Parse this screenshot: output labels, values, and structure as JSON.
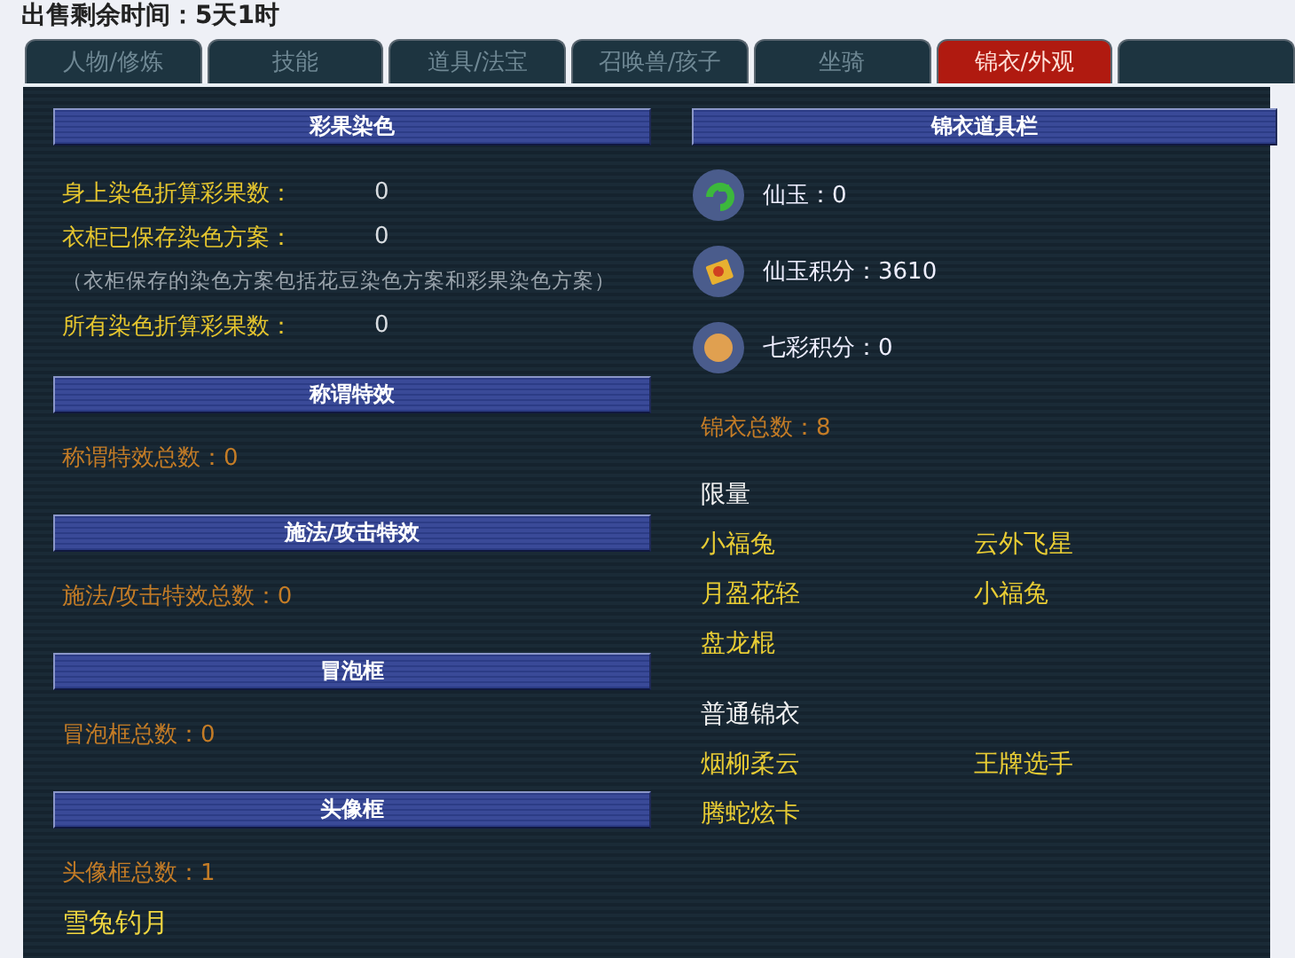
{
  "header_text": "出售剩余时间：5天1时",
  "tabs": [
    {
      "label": "人物/修炼",
      "selected": false
    },
    {
      "label": "技能",
      "selected": false
    },
    {
      "label": "道具/法宝",
      "selected": false
    },
    {
      "label": "召唤兽/孩子",
      "selected": false
    },
    {
      "label": "坐骑",
      "selected": false
    },
    {
      "label": "锦衣/外观",
      "selected": true
    }
  ],
  "left_sections": [
    {
      "title": "彩果染色",
      "rows": [
        {
          "kind": "stat",
          "label": "身上染色折算彩果数：",
          "value": "0"
        },
        {
          "kind": "stat",
          "label": "衣柜已保存染色方案：",
          "value": "0"
        },
        {
          "kind": "note",
          "text": "（衣柜保存的染色方案包括花豆染色方案和彩果染色方案）"
        },
        {
          "kind": "stat",
          "label": "所有染色折算彩果数：",
          "value": "0"
        }
      ]
    },
    {
      "title": "称谓特效",
      "rows": [
        {
          "kind": "total",
          "text": "称谓特效总数：0"
        }
      ]
    },
    {
      "title": "施法/攻击特效",
      "rows": [
        {
          "kind": "total",
          "text": "施法/攻击特效总数：0"
        }
      ]
    },
    {
      "title": "冒泡框",
      "rows": [
        {
          "kind": "total",
          "text": "冒泡框总数：0"
        }
      ]
    },
    {
      "title": "头像框",
      "rows": [
        {
          "kind": "total",
          "text": "头像框总数：1"
        },
        {
          "kind": "item",
          "text": "雪兔钓月"
        }
      ]
    }
  ],
  "right_panel": {
    "title": "锦衣道具栏",
    "currencies": [
      {
        "kind": "jade",
        "text": "仙玉：0"
      },
      {
        "kind": "ticket",
        "text": "仙玉积分：3610"
      },
      {
        "kind": "orb",
        "text": "七彩积分：0"
      }
    ],
    "total": "锦衣总数：8",
    "groups": [
      {
        "title": "限量",
        "items": [
          "小福兔",
          "云外飞星",
          "月盈花轻",
          "小福兔",
          "盘龙棍"
        ]
      },
      {
        "title": "普通锦衣",
        "items": [
          "烟柳柔云",
          "王牌选手",
          "腾蛇炫卡"
        ]
      }
    ]
  }
}
